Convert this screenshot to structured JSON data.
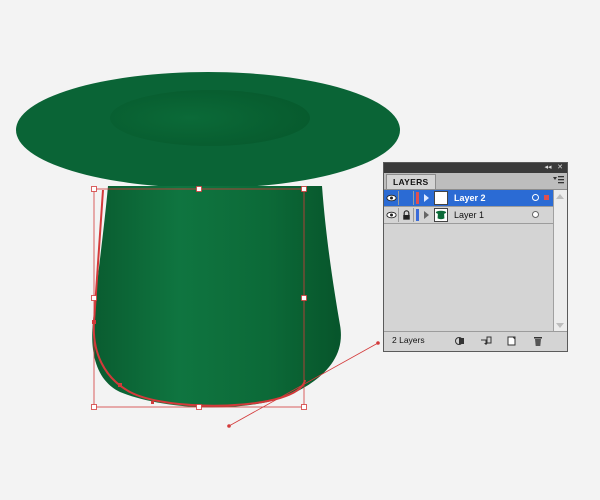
{
  "panel": {
    "tab_label": "LAYERS",
    "layers": [
      {
        "name": "Layer 2",
        "color": "#e05050",
        "selected": true,
        "locked": false
      },
      {
        "name": "Layer 1",
        "color": "#3b6cd9",
        "selected": false,
        "locked": true
      }
    ],
    "footer_count": "2 Layers",
    "icons": {
      "collapse": "double-arrow-icon",
      "close": "close-icon",
      "menu": "panel-menu-icon",
      "eye": "eye-icon",
      "lock": "lock-icon",
      "make_clipping_mask": "clipping-mask-icon",
      "new_sublayer": "new-sublayer-icon",
      "new_layer": "new-layer-icon",
      "delete": "trash-icon"
    }
  },
  "colors": {
    "hat_fill": "#0b6a38",
    "selection": "#d33a3a",
    "selected_row": "#2b6bd4"
  }
}
